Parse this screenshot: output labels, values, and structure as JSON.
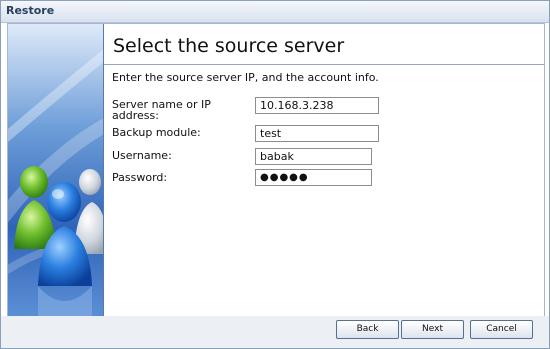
{
  "window": {
    "title": "Restore"
  },
  "main": {
    "heading": "Select the source server",
    "description": "Enter the source server IP, and the account info."
  },
  "form": {
    "server_label": "Server name or IP address:",
    "server_value": "10.168.3.238",
    "module_label": "Backup module:",
    "module_value": "test",
    "username_label": "Username:",
    "username_value": "babak",
    "password_label": "Password:",
    "password_value": "●●●●●"
  },
  "buttons": {
    "back": "Back",
    "next": "Next",
    "cancel": "Cancel"
  },
  "side": {
    "image_icon": "users-group-icon"
  }
}
